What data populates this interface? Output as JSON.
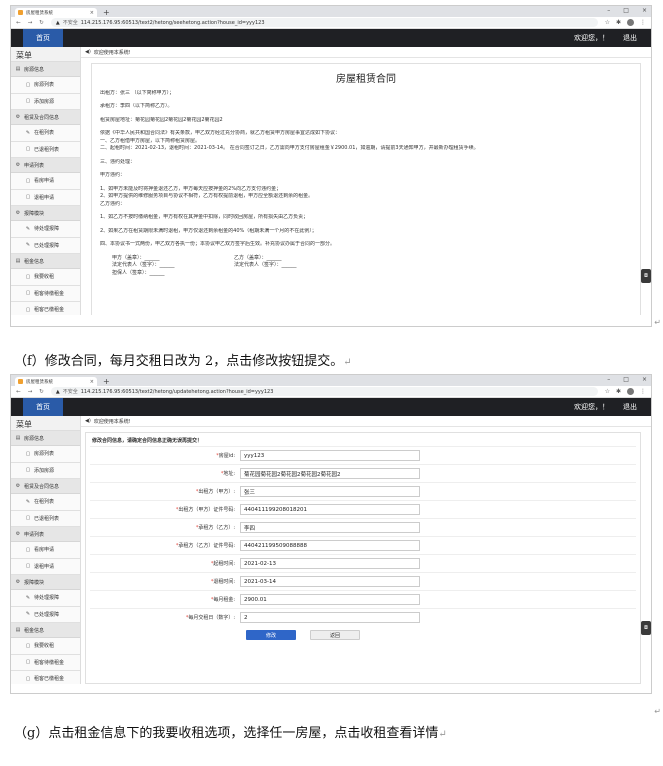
{
  "browser": {
    "tab_title": "房屋租赁系统",
    "insecure_label": "不安全",
    "screen1_url": "114.215.176.95:60513/text2/hetong/seehetong.action?house_id=yyy123",
    "screen2_url": "114.215.176.95:60513/text2/hetong/updatehetong.action?house_id=yyy123"
  },
  "nav": {
    "home": "首页",
    "welcome": "欢迎您，！",
    "logout": "退出"
  },
  "sidebar": {
    "title": "菜单",
    "groups": [
      {
        "label": "房源信息",
        "items": [
          "房源列表",
          "添加房源"
        ]
      },
      {
        "label": "租赁及合同信息",
        "items": [
          "在租列表",
          "已退租列表"
        ]
      },
      {
        "label": "申请列表",
        "items": [
          "看房申请",
          "退租申请"
        ]
      },
      {
        "label": "报障模块",
        "items": [
          "待处理报障",
          "已处理报障"
        ]
      },
      {
        "label": "租金信息",
        "items": [
          "我要收租",
          "租客待缴租金",
          "租客已缴租金"
        ]
      }
    ]
  },
  "welcome_text": "欢迎使用本系统!",
  "contract": {
    "title": "房屋租赁合同",
    "lines": [
      "出租方：张三 （以下简称甲方）；",
      "",
      "承租方：李四（以下简称乙方）。",
      "",
      "租赁房屋地址：菊花园菊花园2菊花园2菊花园2菊花园2",
      "",
      "依据《中华人民共和国合同法》有关条款，甲乙双方经过充分协商，就乙方租赁甲方房屋事宜达成如下协议：",
      "一、乙方租借甲方房屋，以下简称租赁房屋。",
      "二、起租时间：2021-02-13，退租时间：2021-03-14。 在合同签订之日，乙方需向甲方支付房屋租金￥2900.01，如逾期，请提前3天通知甲方，并最新办理租赁手续。",
      "",
      "三、违约处理：",
      "",
      "甲方违约：",
      "",
      "1、如甲方未能及时将押金退还乙方，甲方每天应按押金的2%向乙方支付违约金；",
      "2、如甲方提供的维修服务项目与协议不相符，乙方有权提前退租，甲方应全额退还剩余的租金。",
      "乙方违约：",
      "",
      "1、如乙方不按时缴纳租金，甲方有权在其押金中扣除，同时收回房屋，所有损失由乙方负责；",
      "",
      "2、如果乙方在租赁期限未满时退租，甲方仅退还剩余租金的40%（租期未满一个月的不在此例）；",
      "",
      "四、本协议书一式两份，甲乙双方各执一份；本协议甲乙双方签字后生效。补充协议办属于合同的一部分。"
    ],
    "sign": [
      [
        "甲方（盖章）：______",
        "乙方（盖章）：______"
      ],
      [
        "法定代表人（签字）：______",
        "法定代表人（签字）：______"
      ],
      [
        "担保人（签章）：______",
        ""
      ]
    ]
  },
  "form": {
    "header": "修改合同信息，请确定合同信息正确无误再提交！",
    "fields": [
      {
        "label": "房屋id:",
        "value": "yyy123"
      },
      {
        "label": "地址:",
        "value": "菊花园菊花园2菊花园2菊花园2菊花园2"
      },
      {
        "label": "出租方（甲方）:",
        "value": "张三"
      },
      {
        "label": "出租方（甲方）证件号码:",
        "value": "440411199208018201"
      },
      {
        "label": "承租方（乙方）:",
        "value": "李四"
      },
      {
        "label": "承租方（乙方）证件号码:",
        "value": "440421199509088888"
      },
      {
        "label": "起租时间:",
        "value": "2021-02-13"
      },
      {
        "label": "退租时间:",
        "value": "2021-03-14"
      },
      {
        "label": "每月租金:",
        "value": "2900.01"
      },
      {
        "label": "每月交租日（数字）:",
        "value": "2"
      }
    ],
    "submit": "修改",
    "back": "返回"
  },
  "captions": {
    "f": "（f）修改合同，每月交租日改为 2，点击修改按钮提交。",
    "g": "（g）点击租金信息下的我要收租选项，选择任一房屋，点击收租查看详情"
  }
}
